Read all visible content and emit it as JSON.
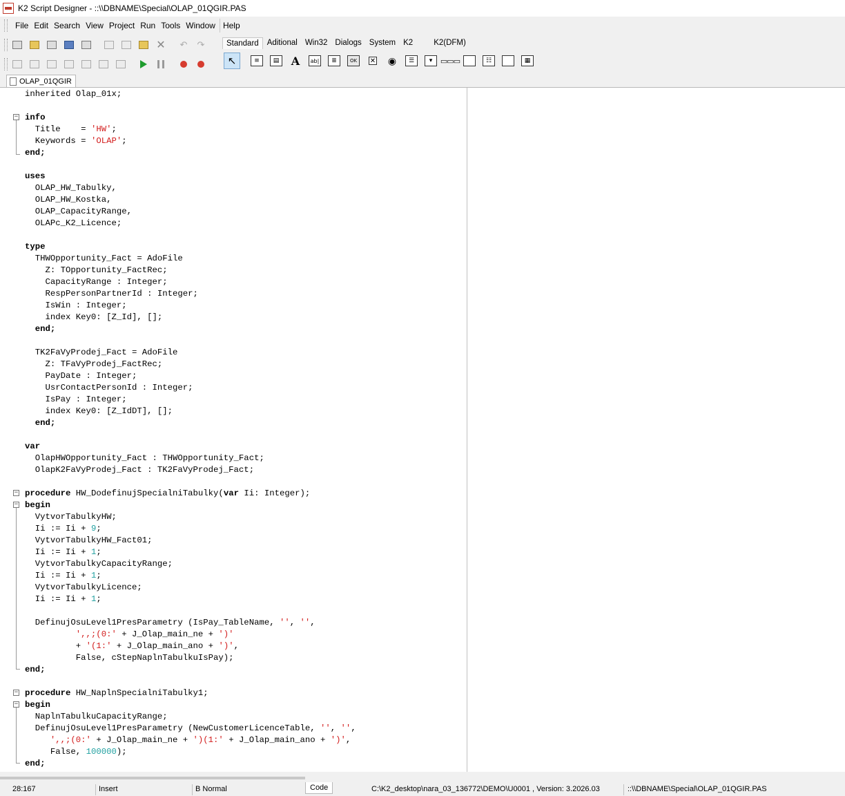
{
  "window": {
    "title": "K2 Script Designer - ::\\\\DBNAME\\Special\\OLAP_01QGIR.PAS"
  },
  "menu": [
    "File",
    "Edit",
    "Search",
    "View",
    "Project",
    "Run",
    "Tools",
    "Window",
    "Help"
  ],
  "palette": {
    "tabs": [
      "Standard",
      "Aditional",
      "Win32",
      "Dialogs",
      "System",
      "K2",
      "K2(DFM)"
    ],
    "active_tab": "Standard",
    "ok_label": "OK"
  },
  "document_tab": "OLAP_01QGIR",
  "status": {
    "position": "28:167",
    "mode": "Insert",
    "encoding": "B Normal",
    "view_tab": "Code",
    "path": "C:\\K2_desktop\\nara_03_136772\\DEMO\\U0001 , Version: 3.2026.03",
    "file": "::\\\\DBNAME\\Special\\OLAP_01QGIR.PAS"
  },
  "code": {
    "l1": "inherited Olap_01x;",
    "info": "info",
    "title_key": "  Title    = ",
    "title_val": "'HW'",
    "keywords_key": "  Keywords = ",
    "keywords_val": "'OLAP'",
    "end": "end;",
    "uses": "uses",
    "u1": "  OLAP_HW_Tabulky,",
    "u2": "  OLAP_HW_Kostka,",
    "u3": "  OLAP_CapacityRange,",
    "u4": "  OLAPc_K2_Licence;",
    "type": "type",
    "t1": "  THWOpportunity_Fact = AdoFile",
    "t2": "    Z: TOpportunity_FactRec;",
    "t3": "    CapacityRange : Integer;",
    "t4": "    RespPersonPartnerId : Integer;",
    "t5": "    IsWin : Integer;",
    "t6": "    index Key0: [Z_Id], [];",
    "tend": "  end;",
    "t7": "  TK2FaVyProdej_Fact = AdoFile",
    "t8": "    Z: TFaVyProdej_FactRec;",
    "t9": "    PayDate : Integer;",
    "t10": "    UsrContactPersonId : Integer;",
    "t11": "    IsPay : Integer;",
    "t12": "    index Key0: [Z_IdDT], [];",
    "var": "var",
    "v1": "  OlapHWOpportunity_Fact : THWOpportunity_Fact;",
    "v2": "  OlapK2FaVyProdej_Fact : TK2FaVyProdej_Fact;",
    "procedure": "procedure",
    "p1": " HW_DodefinujSpecialniTabulky(",
    "var_kw": "var",
    "p1b": " Ii: Integer);",
    "begin": "begin",
    "b1": "  VytvorTabulkyHW;",
    "inc_pre": "  Ii := Ii + ",
    "n9": "9",
    "n1": "1",
    "semi": ";",
    "b2": "  VytvorTabulkyHW_Fact01;",
    "b3": "  VytvorTabulkyCapacityRange;",
    "b4": "  VytvorTabulkyLicence;",
    "d1": "  DefinujOsuLevel1PresParametry (IsPay_TableName, ",
    "empty_str": "''",
    "comma": ", ",
    "trail_comma": ",",
    "d2s": "          ',,;(0:'",
    "d2m": " + J_Olap_main_ne + ",
    "d2e": "')'",
    "d3a": "          + ",
    "d3s": "'(1:'",
    "d3m": " + J_Olap_main_ano + ",
    "d3e": "')'",
    "d4": "          False, cStepNaplnTabulkuIsPay);",
    "p2": " HW_NaplnSpecialniTabulky1;",
    "c1": "  NaplnTabulkuCapacityRange;",
    "c2": "  DefinujOsuLevel1PresParametry (NewCustomerLicenceTable, ",
    "c3s": "     ',,;(0:'",
    "c3m": " + J_Olap_main_ne + ",
    "c3s2": "')(1:'",
    "c3m2": " + J_Olap_main_ano + ",
    "c3e": "')'",
    "c4a": "     False, ",
    "c4n": "100000",
    "c4b": ");"
  }
}
